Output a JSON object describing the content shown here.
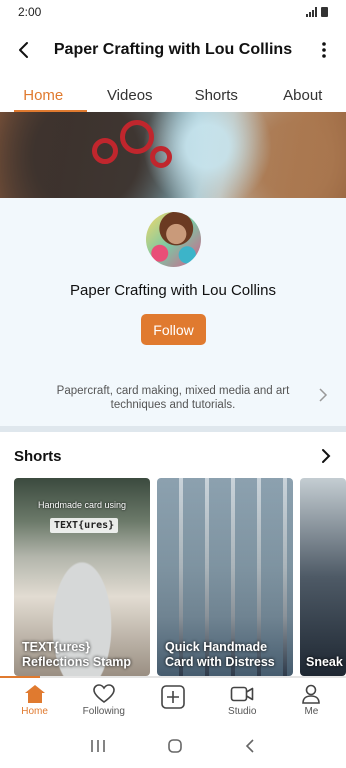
{
  "status_bar": {
    "time": "2:00"
  },
  "header": {
    "title": "Paper Crafting with Lou Collins"
  },
  "tabs": [
    {
      "label": "Home",
      "active": true
    },
    {
      "label": "Videos",
      "active": false
    },
    {
      "label": "Shorts",
      "active": false
    },
    {
      "label": "About",
      "active": false
    }
  ],
  "channel": {
    "name": "Paper Crafting with Lou Collins",
    "follow_label": "Follow",
    "description": "Papercraft, card making, mixed media and art techniques and tutorials."
  },
  "shorts": {
    "title": "Shorts",
    "cards": [
      {
        "top_text": "Handmade card using",
        "tag": "TEXT{ures}",
        "caption": "TEXT{ures} Reflections Stamp"
      },
      {
        "caption": "Quick Handmade Card with Distress"
      },
      {
        "caption": "Sneak & new"
      }
    ]
  },
  "bottom_nav": [
    {
      "label": "Home",
      "icon": "home-icon",
      "active": true
    },
    {
      "label": "Following",
      "icon": "heart-icon",
      "active": false
    },
    {
      "label": "",
      "icon": "create-icon",
      "active": false
    },
    {
      "label": "Studio",
      "icon": "video-camera-icon",
      "active": false
    },
    {
      "label": "Me",
      "icon": "person-icon",
      "active": false
    }
  ],
  "colors": {
    "accent": "#e07a2f",
    "panel_bg": "#f2f8fc"
  }
}
